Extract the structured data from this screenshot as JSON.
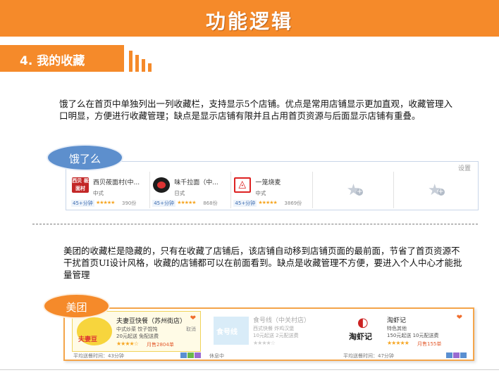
{
  "header": {
    "title": "功能逻辑"
  },
  "section": {
    "label": "4. 我的收藏"
  },
  "paragraphs": {
    "eleme": "饿了么在首页中单独列出一列收藏栏，支持显示5个店铺。优点是常用店铺显示更加直观，收藏管理入口明显，方便进行收藏管理；缺点是显示店铺有限并且占用首页资源与后面显示店铺有重叠。",
    "meituan": "美团的收藏栏是隐藏的，只有在收藏了店铺后，该店铺自动移到店铺页面的最前面，节省了首页资源不干扰首页UI设计风格，收藏的店铺都可以在前面看到。缺点是收藏管理不方便，要进入个人中心才能批量管理"
  },
  "labels": {
    "eleme": "饿了么",
    "meituan": "美团"
  },
  "eleme_panel": {
    "settings": "设置",
    "shops": [
      {
        "name": "西贝莜面村(中...",
        "category": "中式",
        "time": "45+分钟",
        "stars": "★★★★★",
        "count": "390份",
        "logo_text": "西贝 莜面村"
      },
      {
        "name": "味千拉面（中...",
        "category": "日式",
        "time": "45+分钟",
        "stars": "★★★★★",
        "count": "868份"
      },
      {
        "name": "一笼烧麦",
        "category": "中式",
        "time": "45+分钟",
        "stars": "★★★★★",
        "count": "3869份"
      },
      {
        "empty": "★",
        "plus": "+"
      },
      {
        "empty": "★",
        "plus": "+"
      }
    ]
  },
  "meituan_panel": {
    "cards": [
      {
        "name": "夫妻豆快餐（苏州街店）",
        "desc": "中式炒菜  饺子馄饨",
        "desc2": "20元起送  免配送费",
        "stars": "★★★★☆",
        "month": "月售2804单",
        "heart": "❤",
        "cancel": "取消",
        "footer": "平均送餐时间：43分钟"
      },
      {
        "name": "食号线（中关村店）",
        "desc": "西式快餐  炸鸡汉堡",
        "desc2": "10元起送  2元配送费",
        "stars": "★★★★☆",
        "footer": "休息中"
      },
      {
        "name": "淘虾记",
        "desc": "特色其他",
        "desc2": "150元起送   10元配送费",
        "stars": "★★★★★",
        "month": "月售155单",
        "heart": "❤",
        "footer": "平均送餐时间：47分钟"
      }
    ]
  },
  "colors": {
    "accent": "#f58a2a",
    "blue": "#5d8fcd"
  }
}
